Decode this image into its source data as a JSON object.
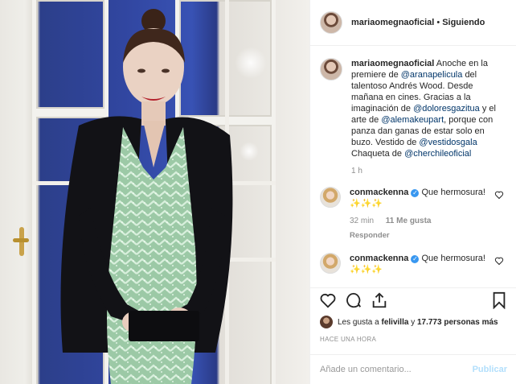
{
  "post_image": {
    "alt_icon": "photo-image"
  },
  "header": {
    "username": "mariaomegnaoficial",
    "separator": "•",
    "follow_status": "Siguiendo"
  },
  "caption": {
    "username": "mariaomegnaoficial",
    "t1": "Anoche en la premiere de",
    "m1": "@aranapelicula",
    "t2": "del talentoso Andrés Wood. Desde mañana en cines. Gracias a la imaginación de",
    "m2": "@doloresgazitua",
    "t3": "y el arte de",
    "m3": "@alemakeupart",
    "t4": ", porque con panza dan ganas de estar solo en buzo. Vestido de",
    "m4": "@vestidosgala",
    "t5": "Chaqueta de",
    "m5": "@cherchileoficial",
    "age": "1 h"
  },
  "comments": [
    {
      "username": "conmackenna",
      "verified": "✓",
      "text": "Que hermosura! ✨✨✨",
      "age": "32 min",
      "likes": "11 Me gusta",
      "reply": "Responder"
    },
    {
      "username": "conmackenna",
      "verified": "✓",
      "text": "Que hermosura! ✨✨✨"
    }
  ],
  "likes_line": {
    "prefix": "Les gusta a",
    "user": "felivilla",
    "middle": "y",
    "count": "17.773 personas más"
  },
  "timestamp": "HACE UNA HORA",
  "add_comment": {
    "placeholder": "Añade un comentario...",
    "publish": "Publicar"
  },
  "colors": {
    "link": "#003569",
    "verified": "#3897f0",
    "publish": "#b2dffc",
    "muted": "#8e8e8e"
  }
}
